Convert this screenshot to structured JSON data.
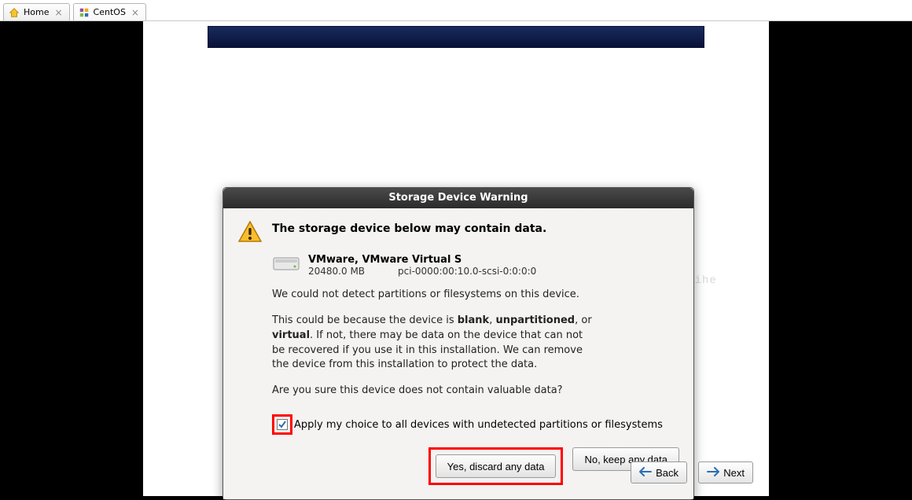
{
  "tabs": [
    {
      "label": "Home"
    },
    {
      "label": "CentOS"
    }
  ],
  "dialog": {
    "title": "Storage Device Warning",
    "heading": "The storage device below may contain data.",
    "device": {
      "name": "VMware, VMware Virtual S",
      "size": "20480.0 MB",
      "path": "pci-0000:00:10.0-scsi-0:0:0:0"
    },
    "line1": "We could not detect partitions or filesystems on this device.",
    "p2_pre": "This could be because the device is ",
    "p2_b1": "blank",
    "p2_mid1": ", ",
    "p2_b2": "unpartitioned",
    "p2_mid2": ", or ",
    "p2_b3": "virtual",
    "p2_post": ". If not, there may be data on the device that can not be recovered if you use it in this installation. We can remove the device from this installation to protect the data.",
    "line3": "Are you sure this device does not contain valuable data?",
    "apply_label": "Apply my choice to all devices with undetected partitions or filesystems",
    "apply_checked": true,
    "yes_label": "Yes, discard any data",
    "no_label": "No, keep any data"
  },
  "nav": {
    "back": "Back",
    "next": "Next"
  },
  "watermark": "sdn.net/CSDN_lihe"
}
